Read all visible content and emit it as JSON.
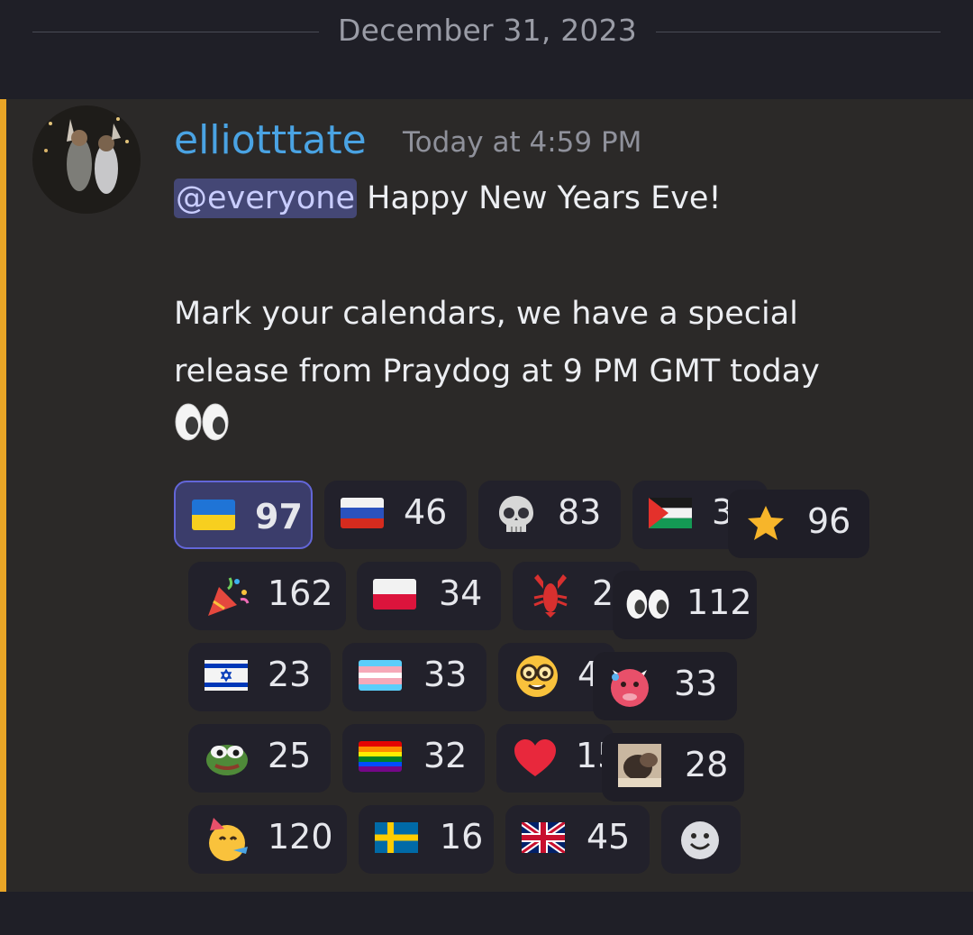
{
  "date_divider": "December 31, 2023",
  "message": {
    "author": "elliotttate",
    "timestamp": "Today at 4:59 PM",
    "mention": "@everyone",
    "line1_rest": " Happy New Years Eve!",
    "line2": "Mark your calendars, we have a special",
    "line3": "release from Praydog at 9 PM GMT today"
  },
  "reactions": [
    {
      "emoji": "ukraine-flag",
      "count": "97",
      "selected": true
    },
    {
      "emoji": "russia-flag",
      "count": "46"
    },
    {
      "emoji": "skull",
      "count": "83"
    },
    {
      "emoji": "palestine-flag",
      "count": "3"
    },
    {
      "emoji": "star",
      "count": "96"
    },
    {
      "emoji": "party-popper",
      "count": "162"
    },
    {
      "emoji": "poland-flag",
      "count": "34"
    },
    {
      "emoji": "lobster",
      "count": "2"
    },
    {
      "emoji": "eyes",
      "count": "112"
    },
    {
      "emoji": "israel-flag",
      "count": "23"
    },
    {
      "emoji": "transgender-flag",
      "count": "33"
    },
    {
      "emoji": "nerd-face",
      "count": "4"
    },
    {
      "emoji": "devil-face",
      "count": "33"
    },
    {
      "emoji": "pepe",
      "count": "25"
    },
    {
      "emoji": "rainbow-flag",
      "count": "32"
    },
    {
      "emoji": "red-heart",
      "count": "15"
    },
    {
      "emoji": "custom-cat",
      "count": "28"
    },
    {
      "emoji": "partying-face",
      "count": "120"
    },
    {
      "emoji": "sweden-flag",
      "count": "16"
    },
    {
      "emoji": "uk-flag",
      "count": "45"
    }
  ],
  "colors": {
    "username": "#4aa3e3",
    "accent_bar": "#e9a526",
    "mention_bg": "#444775",
    "selected_reaction_border": "#6366d8"
  }
}
